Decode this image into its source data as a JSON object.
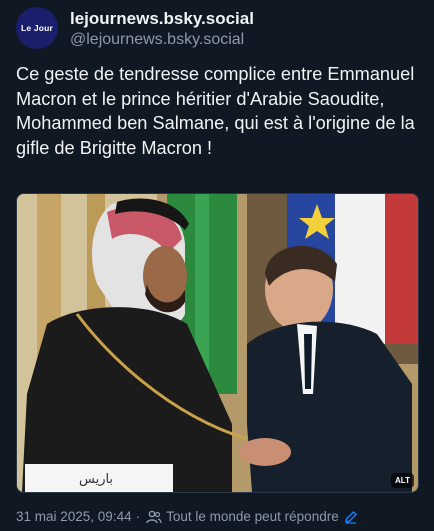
{
  "author": {
    "avatar_text": "Le Jour",
    "display_name": "lejournews.bsky.social",
    "handle": "@lejournews.bsky.social"
  },
  "post": {
    "text": "Ce geste de tendresse complice entre Emmanuel Macron et le prince héritier d'Arabie Saoudite, Mohammed ben Salmane, qui est à l'origine de la gifle de Brigitte Macron !",
    "image_caption_text": "باريس",
    "alt_badge": "ALT"
  },
  "footer": {
    "timestamp": "31 mai 2025, 09:44",
    "separator": "·",
    "reply_setting": "Tout le monde peut répondre"
  },
  "colors": {
    "background": "#0f1823",
    "text": "#f1f3f5",
    "muted": "#8d9aa8",
    "avatar": "#1a1f6b",
    "accent_link": "#1083fe"
  },
  "icons": [
    "people-icon",
    "pencil-icon"
  ]
}
